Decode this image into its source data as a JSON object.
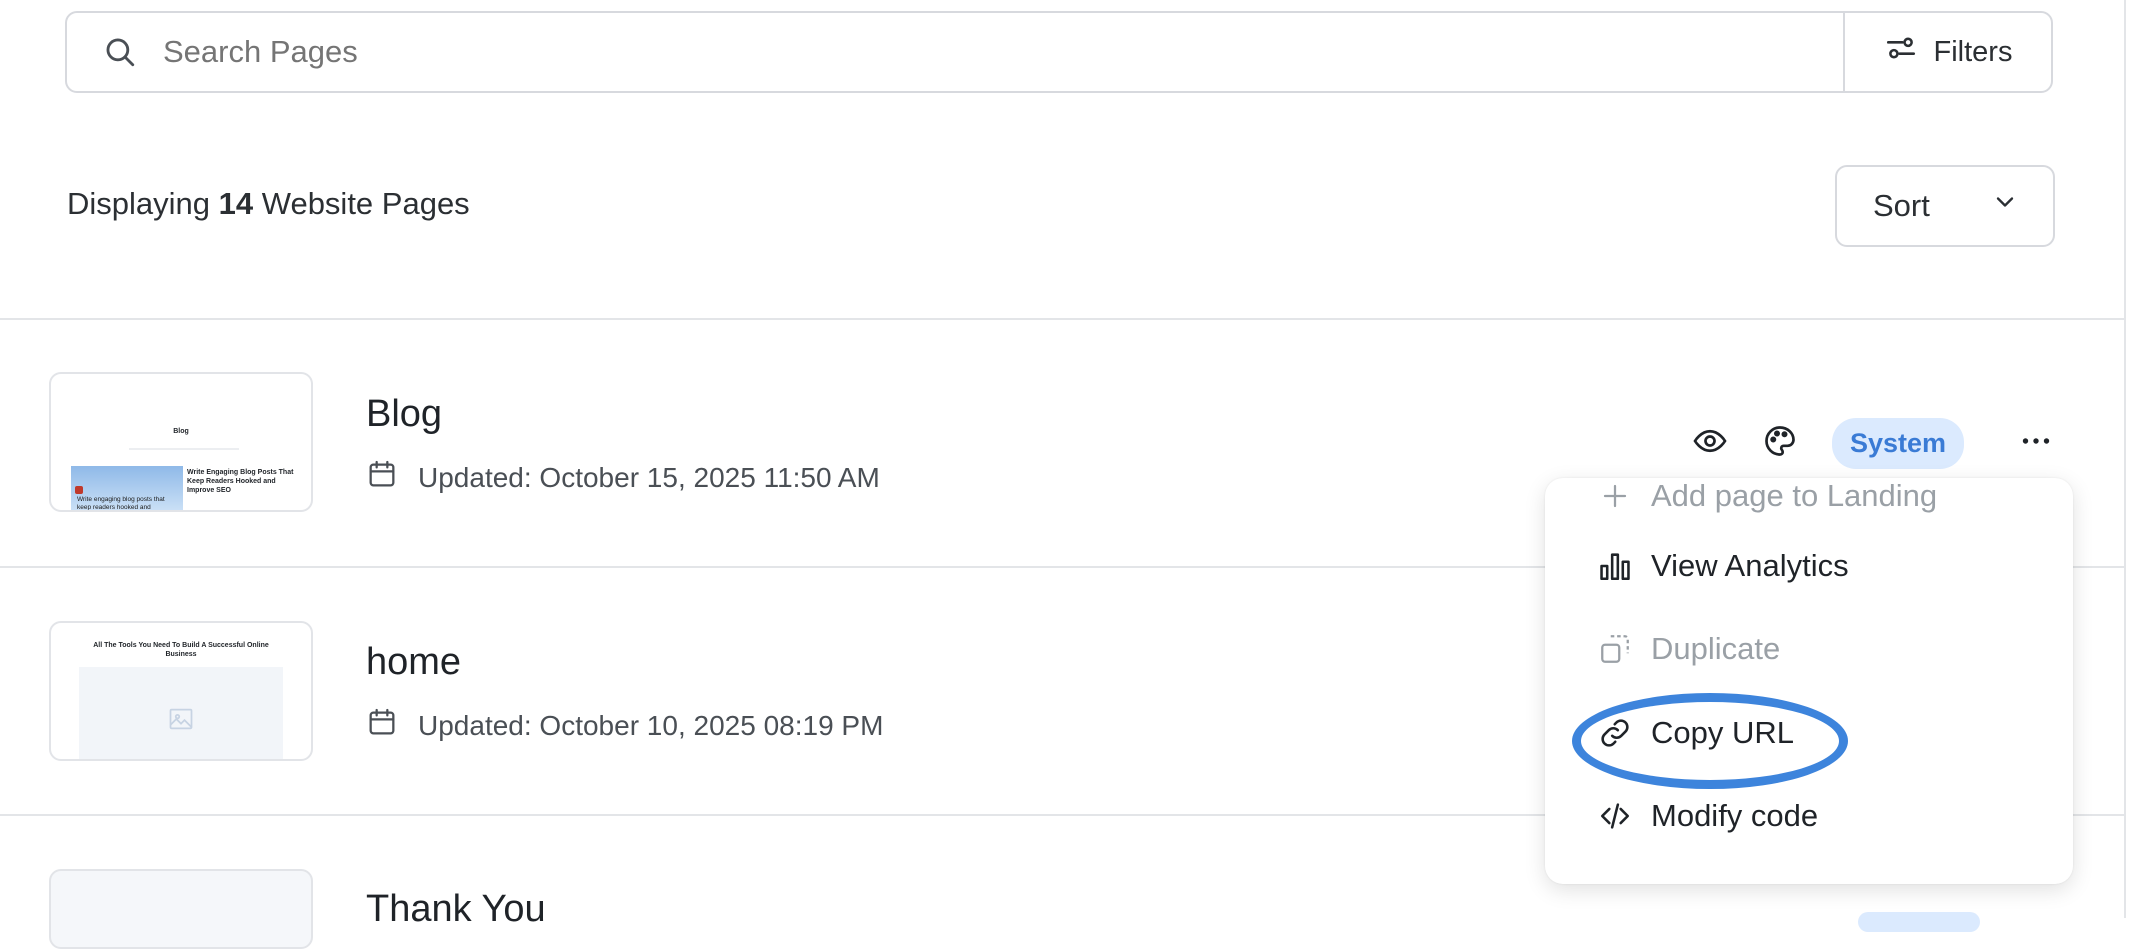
{
  "search": {
    "placeholder": "Search Pages"
  },
  "filters": {
    "label": "Filters"
  },
  "summary": {
    "prefix": "Displaying",
    "count": "14",
    "suffix": "Website Pages"
  },
  "sort": {
    "label": "Sort"
  },
  "pages": [
    {
      "title": "Blog",
      "updated": "Updated: October 15, 2025 11:50 AM",
      "thumb": {
        "heading": "Blog",
        "post_title": "Write Engaging Blog Posts That Keep Readers Hooked and Improve SEO",
        "caption": "Write engaging blog posts that keep readers hooked and"
      }
    },
    {
      "title": "home",
      "updated": "Updated: October 10, 2025 08:19 PM",
      "thumb": {
        "heading": "All The Tools You Need To Build A Successful Online Business"
      }
    },
    {
      "title": "Thank You"
    }
  ],
  "row_badge": "System",
  "menu": {
    "items": [
      {
        "label": "Add page to Landing",
        "icon": "plus-icon",
        "disabled": true
      },
      {
        "label": "View Analytics",
        "icon": "bar-chart-icon",
        "disabled": false
      },
      {
        "label": "Duplicate",
        "icon": "duplicate-icon",
        "disabled": true
      },
      {
        "label": "Copy URL",
        "icon": "link-icon",
        "disabled": false
      },
      {
        "label": "Modify code",
        "icon": "code-icon",
        "disabled": false
      }
    ]
  },
  "colors": {
    "accent": "#3d84dc",
    "badge_bg": "#dbeafe",
    "badge_text": "#3a7bd5"
  }
}
